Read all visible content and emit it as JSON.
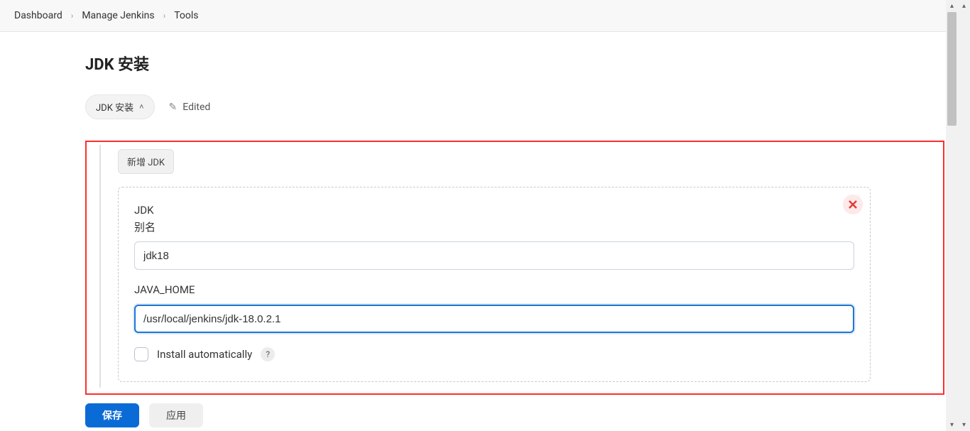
{
  "breadcrumb": {
    "items": [
      "Dashboard",
      "Manage Jenkins",
      "Tools"
    ]
  },
  "page": {
    "title": "JDK 安装"
  },
  "section": {
    "chip_label": "JDK 安装",
    "edited_label": "Edited"
  },
  "panel": {
    "add_button": "新增 JDK",
    "jdk": {
      "group_label": "JDK",
      "alias_label": "别名",
      "alias_value": "jdk18",
      "java_home_label": "JAVA_HOME",
      "java_home_value": "/usr/local/jenkins/jdk-18.0.2.1",
      "install_auto_label": "Install automatically",
      "help_char": "?"
    }
  },
  "actions": {
    "save": "保存",
    "apply": "应用"
  }
}
